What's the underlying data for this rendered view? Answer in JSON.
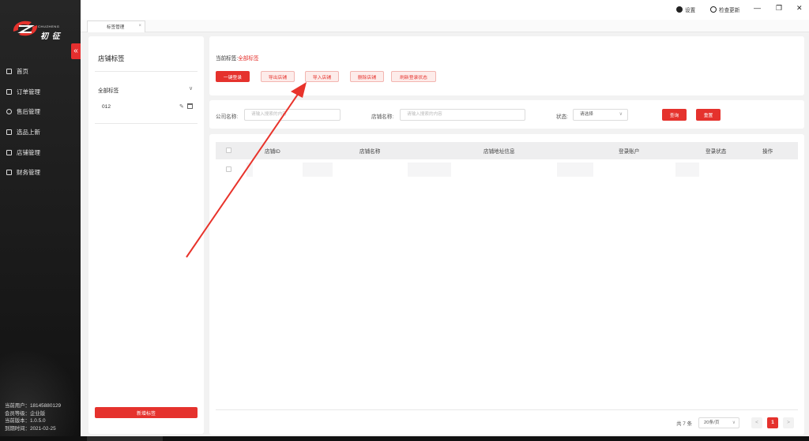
{
  "colors": {
    "accent": "#e5322d",
    "sidebar_bg": "#1b1b1b",
    "arrow": "#e8332b"
  },
  "brand": {
    "small": "CHUZHENG",
    "big": "初 征"
  },
  "sidebar": {
    "collapse_icon": "«",
    "items": [
      {
        "label": "首页",
        "icon": "home-icon"
      },
      {
        "label": "订单管理",
        "icon": "order-icon"
      },
      {
        "label": "售后管理",
        "icon": "after-sales-icon"
      },
      {
        "label": "选品上新",
        "icon": "product-select-icon"
      },
      {
        "label": "店铺管理",
        "icon": "shop-icon"
      },
      {
        "label": "财务管理",
        "icon": "finance-icon"
      }
    ],
    "user_info": [
      "当前用户：18145880129",
      "会员等级：企业版",
      "当前版本：1.0.5.0",
      "到期时间：2021-02-25"
    ]
  },
  "topbar": {
    "settings_label": "设置",
    "update_label": "检查更新",
    "minimize": "—",
    "restore": "❐",
    "close": "✕"
  },
  "tabs": [
    {
      "label": "标签管理",
      "close": "×"
    }
  ],
  "label_panel": {
    "title": "店铺标签",
    "all_label": "全部标签",
    "chevron": "∨",
    "items": [
      {
        "name": "012"
      }
    ],
    "edit_icon": "✎",
    "add_button": "新增标签"
  },
  "action_panel": {
    "current_prefix": "当前标签:",
    "current_value": "全部标签",
    "buttons": [
      "一键登录",
      "导出店铺",
      "导入店铺",
      "删除店铺",
      "刷新登录状态"
    ]
  },
  "filter": {
    "company_label": "公司名称:",
    "company_placeholder": "请输入搜索的内容",
    "shop_label": "店铺名称:",
    "shop_placeholder": "请输入搜索的内容",
    "status_label": "状态:",
    "status_value": "请选择",
    "search_button": "查询",
    "reset_button": "重置"
  },
  "table": {
    "columns": [
      "店铺ID",
      "店铺名称",
      "店铺地址信息",
      "登录账户",
      "登录状态",
      "操作"
    ]
  },
  "pagination": {
    "total": "共 7 条",
    "page_size": "20条/页",
    "prev": "<",
    "current_page": "1",
    "next": ">"
  }
}
